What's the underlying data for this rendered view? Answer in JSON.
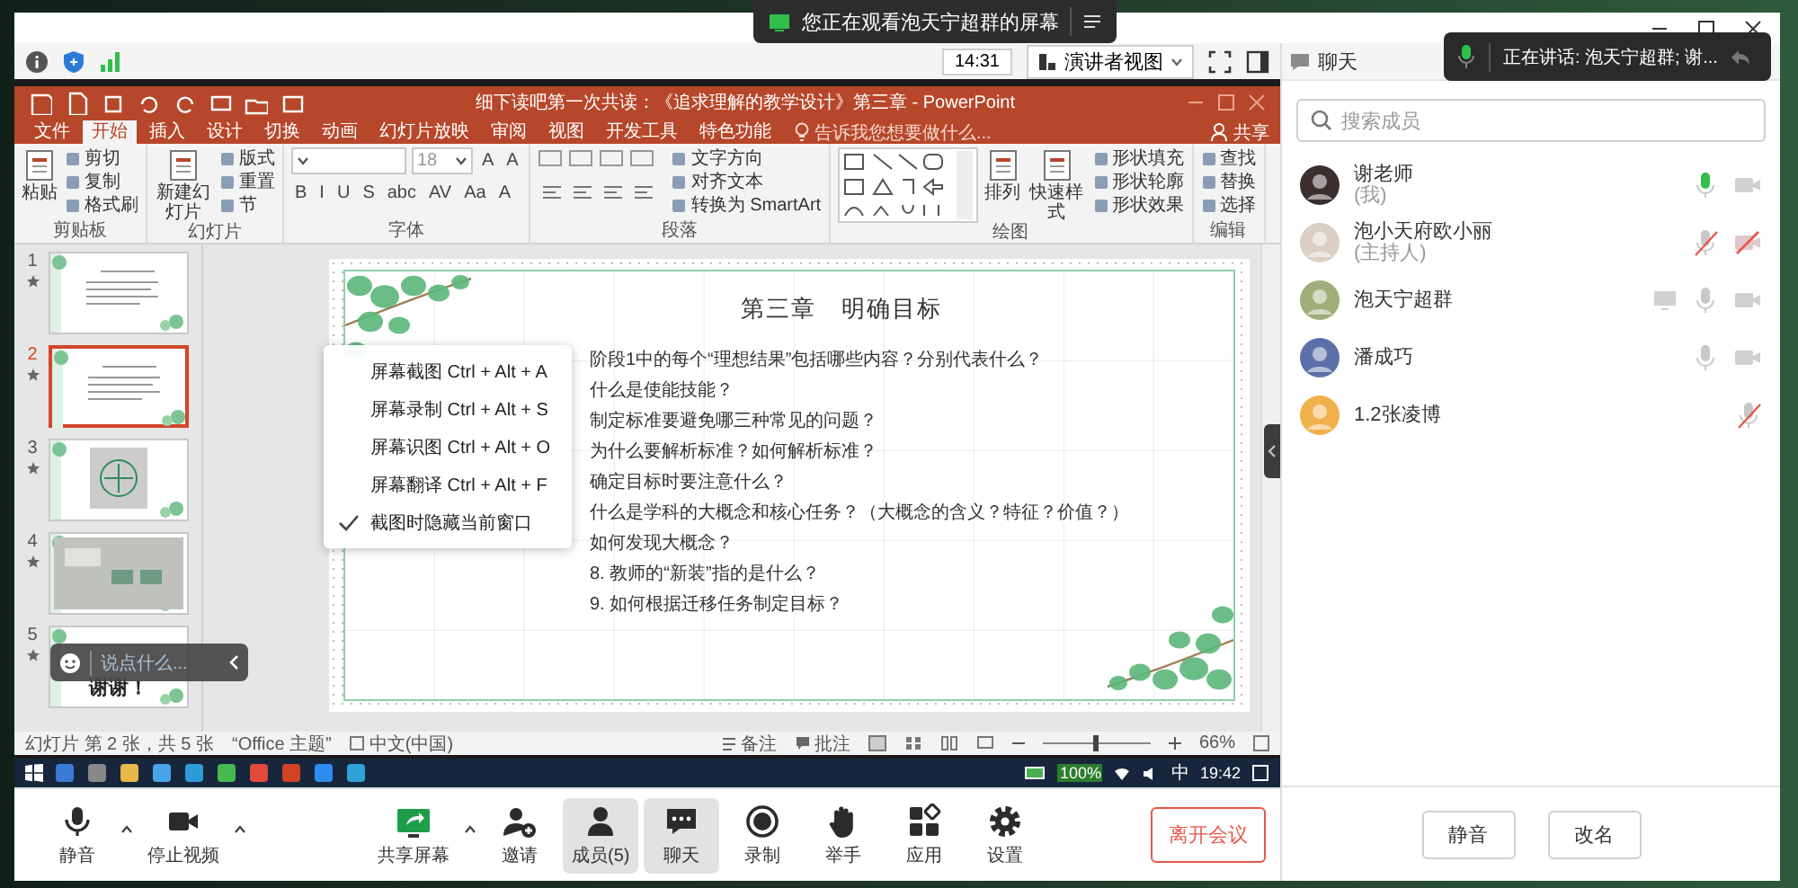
{
  "banner": {
    "text": "您正在观看泡天宁超群的屏幕"
  },
  "toolbar": {
    "time": "14:31",
    "view_mode": "演讲者视图"
  },
  "speaking_toast": {
    "text": "正在讲话: 泡天宁超群; 谢..."
  },
  "powerpoint": {
    "title": "细下读吧第一次共读：《追求理解的教学设计》第三章 - PowerPoint",
    "tabs": [
      {
        "label": "文件",
        "selected": false
      },
      {
        "label": "开始",
        "selected": true
      },
      {
        "label": "插入",
        "selected": false
      },
      {
        "label": "设计",
        "selected": false
      },
      {
        "label": "切换",
        "selected": false
      },
      {
        "label": "动画",
        "selected": false
      },
      {
        "label": "幻灯片放映",
        "selected": false
      },
      {
        "label": "审阅",
        "selected": false
      },
      {
        "label": "视图",
        "selected": false
      },
      {
        "label": "开发工具",
        "selected": false
      },
      {
        "label": "特色功能",
        "selected": false
      }
    ],
    "tell_me": "告诉我您想要做什么...",
    "share": "共享",
    "ribbon": [
      {
        "label": "剪贴板",
        "items": [
          {
            "kind": "large",
            "label": "粘贴"
          },
          {
            "kind": "small",
            "label": "剪切"
          },
          {
            "kind": "small",
            "label": "复制"
          },
          {
            "kind": "small",
            "label": "格式刷"
          }
        ]
      },
      {
        "label": "幻灯片",
        "items": [
          {
            "kind": "large",
            "label": "新建幻灯片"
          },
          {
            "kind": "small",
            "label": "版式"
          },
          {
            "kind": "small",
            "label": "重置"
          },
          {
            "kind": "small",
            "label": "节"
          }
        ]
      },
      {
        "label": "字体",
        "rows": [
          [
            {
              "kind": "field"
            },
            {
              "kind": "field",
              "value": "18"
            },
            {
              "kind": "glyph",
              "label": "A"
            },
            {
              "kind": "glyph",
              "label": "A"
            }
          ],
          [
            {
              "kind": "glyph",
              "label": "B"
            },
            {
              "kind": "glyph",
              "label": "I"
            },
            {
              "kind": "glyph",
              "label": "U"
            },
            {
              "kind": "glyph",
              "label": "S"
            },
            {
              "kind": "glyph",
              "label": "abc"
            },
            {
              "kind": "glyph",
              "label": "AV"
            },
            {
              "kind": "glyph",
              "label": "Aa"
            },
            {
              "kind": "glyph",
              "label": "A"
            }
          ]
        ]
      },
      {
        "label": "段落",
        "items": [
          {
            "kind": "toolset"
          },
          {
            "kind": "small",
            "label": "文字方向"
          },
          {
            "kind": "small",
            "label": "对齐文本"
          },
          {
            "kind": "small",
            "label": "转换为 SmartArt"
          }
        ]
      },
      {
        "label": "绘图",
        "items": [
          {
            "kind": "gallery"
          },
          {
            "kind": "large",
            "label": "排列"
          },
          {
            "kind": "large",
            "label": "快速样式"
          },
          {
            "kind": "small",
            "label": "形状填充"
          },
          {
            "kind": "small",
            "label": "形状轮廓"
          },
          {
            "kind": "small",
            "label": "形状效果"
          }
        ]
      },
      {
        "label": "编辑",
        "items": [
          {
            "kind": "small",
            "label": "查找"
          },
          {
            "kind": "small",
            "label": "替换"
          },
          {
            "kind": "small",
            "label": "选择"
          }
        ]
      }
    ],
    "thumbnails": [
      {
        "number": "1",
        "selected": false
      },
      {
        "number": "2",
        "selected": true
      },
      {
        "number": "3",
        "selected": false
      },
      {
        "number": "4",
        "selected": false
      },
      {
        "number": "5",
        "selected": false,
        "text": "谢谢！"
      }
    ],
    "slide": {
      "title": "第三章　明确目标",
      "lines": [
        "阶段1中的每个“理想结果”包括哪些内容？分别代表什么？",
        "什么是使能技能？",
        "制定标准要避免哪三种常见的问题？",
        "为什么要解析标准？如何解析标准？",
        "确定目标时要注意什么？",
        "什么是学科的大概念和核心任务？（大概念的含义？特征？价值？）",
        "如何发现大概念？",
        "8. 教师的“新装”指的是什么？",
        "9. 如何根据迁移任务制定目标？"
      ]
    },
    "status_bar": {
      "slide_info": "幻灯片 第 2 张，共 5 张",
      "theme": "“Office 主题”",
      "language": "中文(中国)",
      "notes": "备注",
      "comments": "批注",
      "zoom": {
        "level": 0.5,
        "reading": "66%"
      }
    }
  },
  "capture_menu": [
    {
      "label": "屏幕截图 Ctrl + Alt + A",
      "checked": false
    },
    {
      "label": "屏幕录制 Ctrl + Alt + S",
      "checked": false
    },
    {
      "label": "屏幕识图 Ctrl + Alt + O",
      "checked": false
    },
    {
      "label": "屏幕翻译 Ctrl + Alt + F",
      "checked": false
    },
    {
      "label": "截图时隐藏当前窗口",
      "checked": true
    }
  ],
  "chat_input": {
    "placeholder": "说点什么..."
  },
  "taskbar": {
    "battery": "100%",
    "ime": "中",
    "time": "19:42"
  },
  "bottom_toolbar": {
    "buttons": [
      {
        "kind": "mic",
        "label": "静音",
        "menu": true,
        "selected": false
      },
      {
        "kind": "video",
        "label": "停止视频",
        "menu": true,
        "selected": false
      },
      {
        "kind": "share",
        "label": "共享屏幕",
        "menu": true,
        "selected": false
      },
      {
        "kind": "invite",
        "label": "邀请",
        "menu": false,
        "selected": false
      },
      {
        "kind": "members",
        "label": "成员(5)",
        "menu": false,
        "selected": true
      },
      {
        "kind": "chat",
        "label": "聊天",
        "menu": false,
        "selected": true
      },
      {
        "kind": "record",
        "label": "录制",
        "menu": false,
        "selected": false
      },
      {
        "kind": "hand",
        "label": "举手",
        "menu": false,
        "selected": false
      },
      {
        "kind": "apps",
        "label": "应用",
        "menu": false,
        "selected": false
      },
      {
        "kind": "settings",
        "label": "设置",
        "menu": false,
        "selected": false
      }
    ],
    "leave": "离开会议"
  },
  "members_panel": {
    "header": "聊天",
    "search": {
      "placeholder": "搜索成员"
    },
    "members": [
      {
        "name": "谢老师",
        "role": "(我)",
        "sharing": false,
        "speaking": true,
        "mic_muted": false,
        "camera": true,
        "camera_blocked": false
      },
      {
        "name": "泡小天府欧小丽",
        "role": "(主持人)",
        "sharing": false,
        "speaking": false,
        "mic_muted": true,
        "camera": true,
        "camera_blocked": true
      },
      {
        "name": "泡天宁超群",
        "sharing": true,
        "speaking": false,
        "mic_muted": false,
        "camera": true,
        "camera_blocked": false
      },
      {
        "name": "潘成巧",
        "sharing": false,
        "speaking": false,
        "mic_muted": false,
        "camera": true,
        "camera_blocked": false
      },
      {
        "name": "1.2张凌博",
        "sharing": false,
        "speaking": false,
        "mic_muted": true,
        "camera": false
      }
    ],
    "buttons": [
      "静音",
      "改名"
    ]
  }
}
